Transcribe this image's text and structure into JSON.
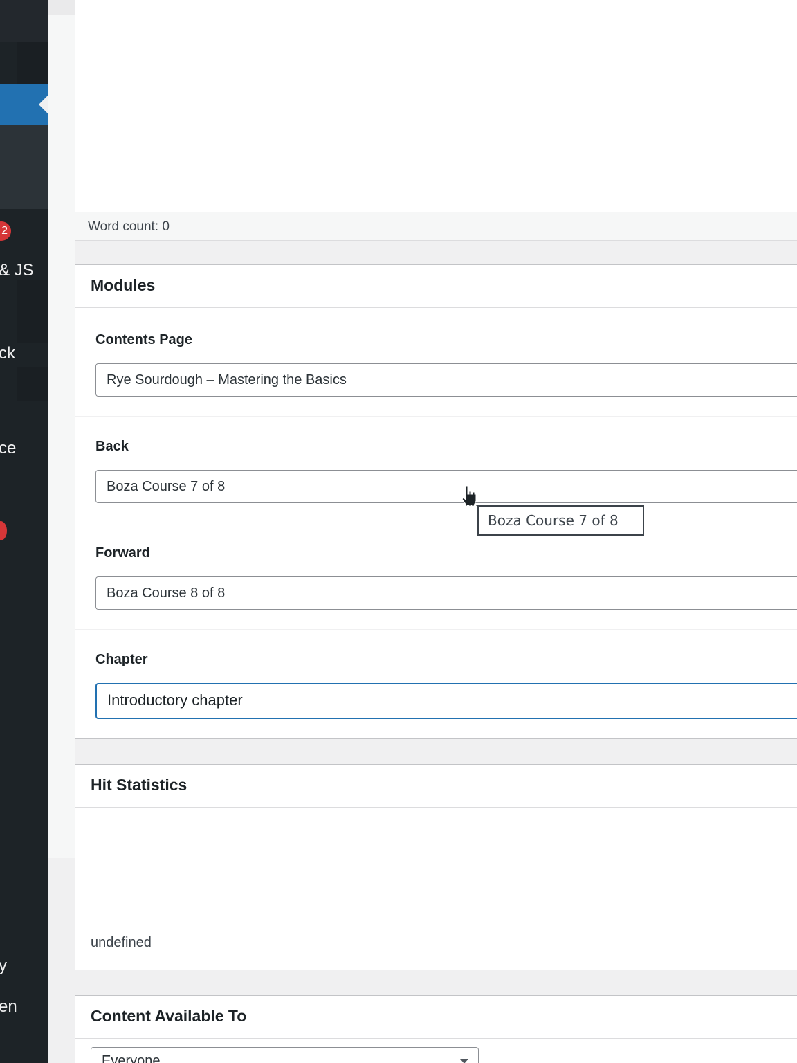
{
  "sidebar": {
    "badge_top": "2",
    "label_css_js": "& JS",
    "label_back": "ck",
    "label_ce": "ce",
    "badge_bottom": "",
    "label_y": "y",
    "label_en": "en"
  },
  "editor": {
    "word_count": "Word count: 0"
  },
  "modules": {
    "title": "Modules",
    "contents_page": {
      "label": "Contents Page",
      "value": "Rye Sourdough – Mastering the Basics"
    },
    "back": {
      "label": "Back",
      "value": "Boza Course 7 of 8"
    },
    "forward": {
      "label": "Forward",
      "value": "Boza Course 8 of 8"
    },
    "chapter": {
      "label": "Chapter",
      "value": "Introductory chapter"
    },
    "tooltip": "Boza Course 7 of 8"
  },
  "hit_statistics": {
    "title": "Hit Statistics",
    "body": "undefined"
  },
  "content_available": {
    "title": "Content Available To",
    "selected": "Everyone"
  },
  "colors": {
    "sidebar_bg": "#1d2327",
    "accent": "#2271b1",
    "badge": "#d63638"
  }
}
